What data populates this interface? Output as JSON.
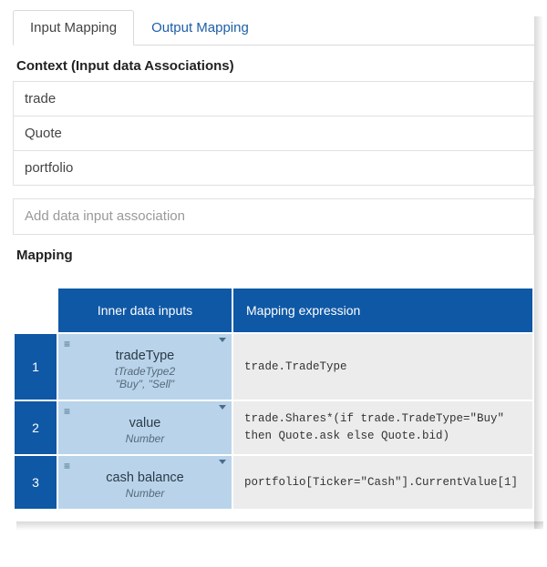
{
  "tabs": {
    "input": "Input Mapping",
    "output": "Output Mapping"
  },
  "context": {
    "title": "Context (Input data Associations)",
    "items": [
      "trade",
      "Quote",
      "portfolio"
    ],
    "add_placeholder": "Add data input association"
  },
  "mapping": {
    "title": "Mapping",
    "headers": {
      "inputs": "Inner data inputs",
      "expr": "Mapping expression"
    },
    "rows": [
      {
        "num": "1",
        "name": "tradeType",
        "type": "tTradeType2",
        "enum": "\"Buy\", \"Sell\"",
        "expr": "trade.TradeType"
      },
      {
        "num": "2",
        "name": "value",
        "type": "Number",
        "enum": "",
        "expr": "trade.Shares*(if trade.TradeType=\"Buy\" then Quote.ask else Quote.bid)"
      },
      {
        "num": "3",
        "name": "cash balance",
        "type": "Number",
        "enum": "",
        "expr": "portfolio[Ticker=\"Cash\"].CurrentValue[1]"
      }
    ]
  }
}
